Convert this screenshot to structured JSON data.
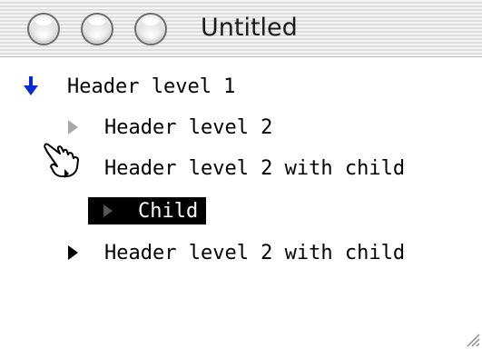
{
  "window": {
    "title": "Untitled"
  },
  "outline": {
    "items": [
      {
        "label": "Header level 1",
        "state": "expanded"
      },
      {
        "label": "Header level 2",
        "state": "leaf"
      },
      {
        "label": "Header level 2 with child",
        "state": "expanded"
      },
      {
        "label": "Child",
        "state": "selected"
      },
      {
        "label": "Header level 2 with child",
        "state": "collapsed"
      }
    ]
  },
  "colors": {
    "disclosure_expanded": "#0a2ad6",
    "selection_background": "#000000",
    "selection_text": "#ffffff"
  },
  "icons": {
    "cursor": "pointing-hand-cursor-icon",
    "grow": "resize-grip-icon"
  }
}
